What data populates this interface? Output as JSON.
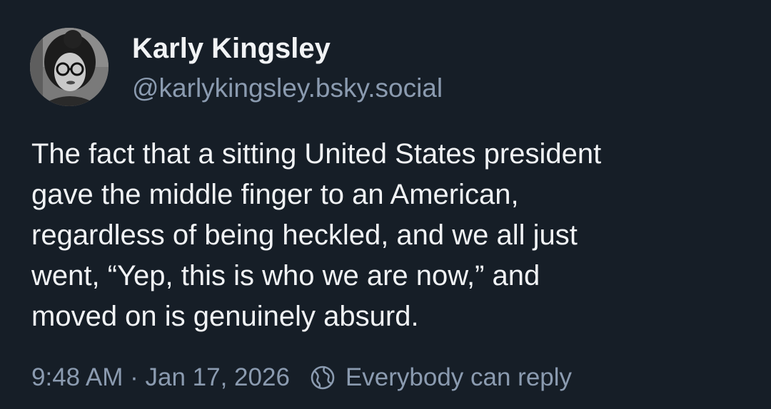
{
  "post": {
    "author": {
      "display_name": "Karly Kingsley",
      "handle": "@karlykingsley.bsky.social"
    },
    "text_lines": [
      "The fact that a sitting United States president",
      "gave the middle finger to an American,",
      "regardless of being heckled, and we all just",
      "went, “Yep, this is who we are now,” and",
      "moved on is genuinely absurd."
    ],
    "timestamp": "9:48 AM · Jan 17, 2026",
    "reply_setting": "Everybody can reply",
    "reply_setting_icon": "globe-icon"
  },
  "colors": {
    "background": "#161e27",
    "primary_text": "#f1f3f5",
    "secondary_text": "#8b9bb0"
  }
}
